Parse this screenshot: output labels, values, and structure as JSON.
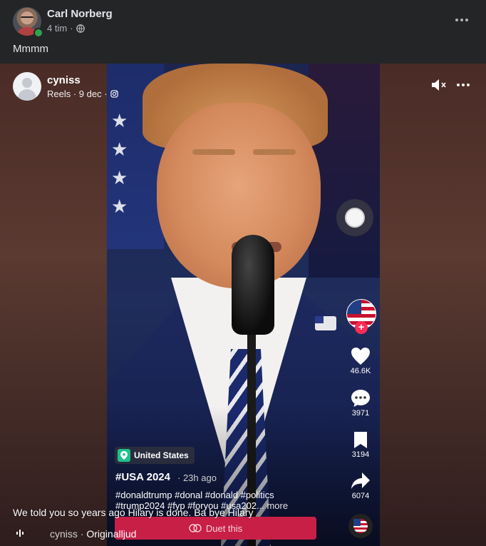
{
  "post": {
    "author": "Carl Norberg",
    "time": "4 tim",
    "separator": "·",
    "text": "Mmmm"
  },
  "reel": {
    "author": "cyniss",
    "meta": "Reels · 9 dec ·",
    "sidebar": {
      "likes": "46.6K",
      "comments": "3971",
      "saves": "3194",
      "shares": "6074"
    },
    "location": "United States",
    "title": "#USA 2024",
    "posted": "· 23h ago",
    "hashtags_line1": "#donaldtrump #donal #donald #politics",
    "hashtags_line2": "#trump2024 #fyp #foryou #usa202",
    "more": "... more",
    "duet_label": "Duet this",
    "caption": "We told you so years ago Hilary is done. Ba bye Hilary",
    "audio_owner": "cyniss",
    "audio_sep": " · ",
    "audio_title": "Originalljud"
  },
  "icons": {
    "globe": "globe-icon",
    "instagram": "instagram-icon",
    "mute": "speaker-muted-icon",
    "heart": "heart-icon",
    "comment": "comment-icon",
    "bookmark": "bookmark-icon",
    "share": "share-icon",
    "location": "location-pin-icon",
    "duet": "duet-icon",
    "audio": "audio-wave-icon"
  },
  "colors": {
    "background": "#242526",
    "online": "#31a24c",
    "duet_button": "#c81f47",
    "follow_plus": "#fe2c55",
    "location_badge": "#20c08a"
  }
}
